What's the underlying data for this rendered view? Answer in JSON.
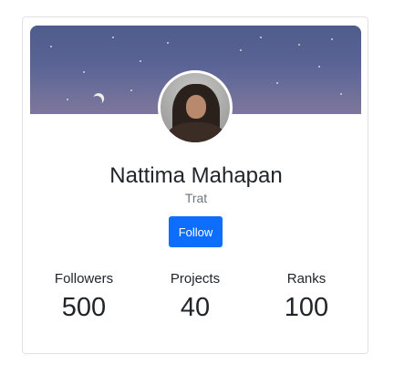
{
  "profile": {
    "name": "Nattima Mahapan",
    "location": "Trat",
    "follow_label": "Follow"
  },
  "stats": [
    {
      "label": "Followers",
      "value": "500"
    },
    {
      "label": "Projects",
      "value": "40"
    },
    {
      "label": "Ranks",
      "value": "100"
    }
  ],
  "colors": {
    "button": "#0d6efd",
    "banner": "#5a6495"
  }
}
